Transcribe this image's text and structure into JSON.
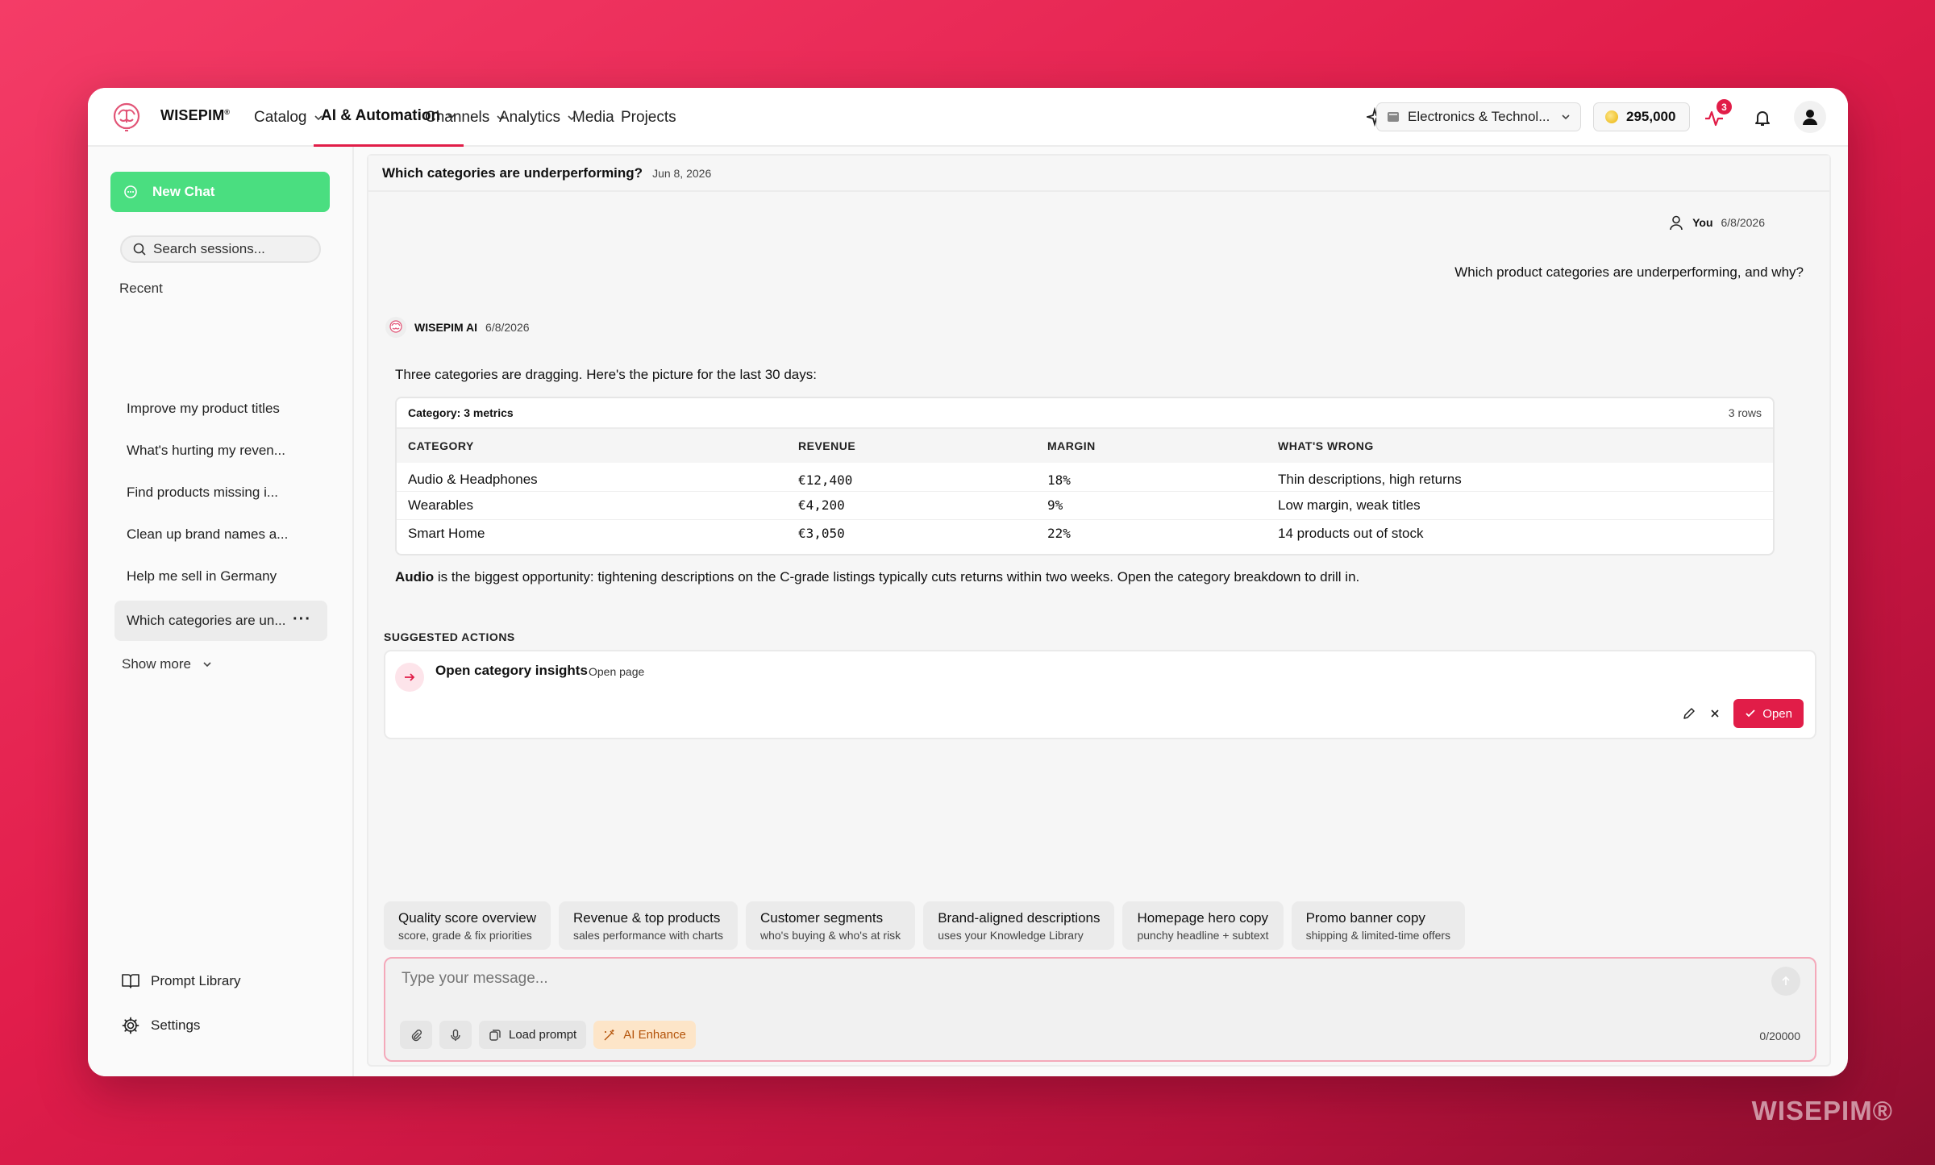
{
  "brand": {
    "name": "WISEPIM",
    "mark": "®"
  },
  "nav": {
    "items": [
      {
        "label": "Catalog",
        "has_dropdown": true
      },
      {
        "label": "AI & Automation",
        "has_dropdown": true,
        "active": true
      },
      {
        "label": "Channels",
        "has_dropdown": true
      },
      {
        "label": "Analytics",
        "has_dropdown": true
      },
      {
        "label": "Media",
        "has_dropdown": false
      },
      {
        "label": "Projects",
        "has_dropdown": false
      }
    ],
    "catalog_selector": "Electronics & Technol...",
    "credits": "295,000",
    "activity_badge": "3",
    "accent": "#e11d48"
  },
  "sidebar": {
    "new_chat": "New Chat",
    "search_placeholder": "Search sessions...",
    "recent_label": "Recent",
    "sessions": [
      "Improve my product titles",
      "What's hurting my reven...",
      "Find products missing i...",
      "Clean up brand names a...",
      "Help me sell in Germany",
      "Which categories are un..."
    ],
    "show_more": "Show more",
    "prompt_library": "Prompt Library",
    "settings": "Settings"
  },
  "conversation": {
    "title": "Which categories are underperforming?",
    "date": "Jun 8, 2026",
    "user_name": "You",
    "user_date": "6/8/2026",
    "user_message": "Which product categories are underperforming, and why?",
    "ai_name": "WISEPIM AI",
    "ai_date": "6/8/2026",
    "ai_intro": "Three categories are dragging. Here's the picture for the last 30 days:",
    "table": {
      "caption": "Category: 3 metrics",
      "row_count": "3 rows",
      "headers": [
        "CATEGORY",
        "REVENUE",
        "MARGIN",
        "WHAT'S WRONG"
      ],
      "rows": [
        [
          "Audio & Headphones",
          "€12,400",
          "18%",
          "Thin descriptions, high returns"
        ],
        [
          "Wearables",
          "€4,200",
          "9%",
          "Low margin, weak titles"
        ],
        [
          "Smart Home",
          "€3,050",
          "22%",
          "14 products out of stock"
        ]
      ]
    },
    "ai_outro_bold": "Audio",
    "ai_outro_rest": " is the biggest opportunity: tightening descriptions on the C-grade listings typically cuts returns within two weeks. Open the category breakdown to drill in."
  },
  "suggested_actions": {
    "label": "SUGGESTED ACTIONS",
    "items": [
      {
        "title": "Open category insights",
        "subtitle": "Open page",
        "button": "Open"
      }
    ]
  },
  "prompt_chips": [
    {
      "title": "Quality score overview",
      "subtitle": "score, grade & fix priorities"
    },
    {
      "title": "Revenue & top products",
      "subtitle": "sales performance with charts"
    },
    {
      "title": "Customer segments",
      "subtitle": "who's buying & who's at risk"
    },
    {
      "title": "Brand-aligned descriptions",
      "subtitle": "uses your Knowledge Library"
    },
    {
      "title": "Homepage hero copy",
      "subtitle": "punchy headline + subtext"
    },
    {
      "title": "Promo banner copy",
      "subtitle": "shipping & limited-time offers"
    }
  ],
  "composer": {
    "placeholder": "Type your message...",
    "load_prompt": "Load prompt",
    "ai_enhance": "AI Enhance",
    "counter": "0/20000"
  },
  "watermark": "WISEPIM®"
}
